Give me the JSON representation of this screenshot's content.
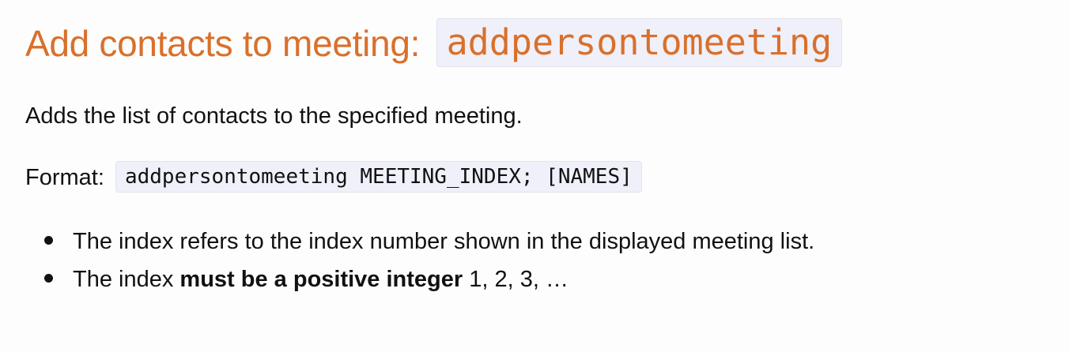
{
  "heading": {
    "text": "Add contacts to meeting:",
    "command": "addpersontomeeting"
  },
  "description": "Adds the list of contacts to the specified meeting.",
  "format": {
    "label": "Format:",
    "code": "addpersontomeeting MEETING_INDEX; [NAMES]"
  },
  "bullets": [
    {
      "text": "The index refers to the index number shown in the displayed meeting list."
    },
    {
      "prefix": "The index ",
      "bold": "must be a positive integer",
      "suffix": " 1, 2, 3, …"
    }
  ],
  "colors": {
    "heading": "#d9702b",
    "code_background": "#f0f0fa",
    "text": "#111111"
  }
}
